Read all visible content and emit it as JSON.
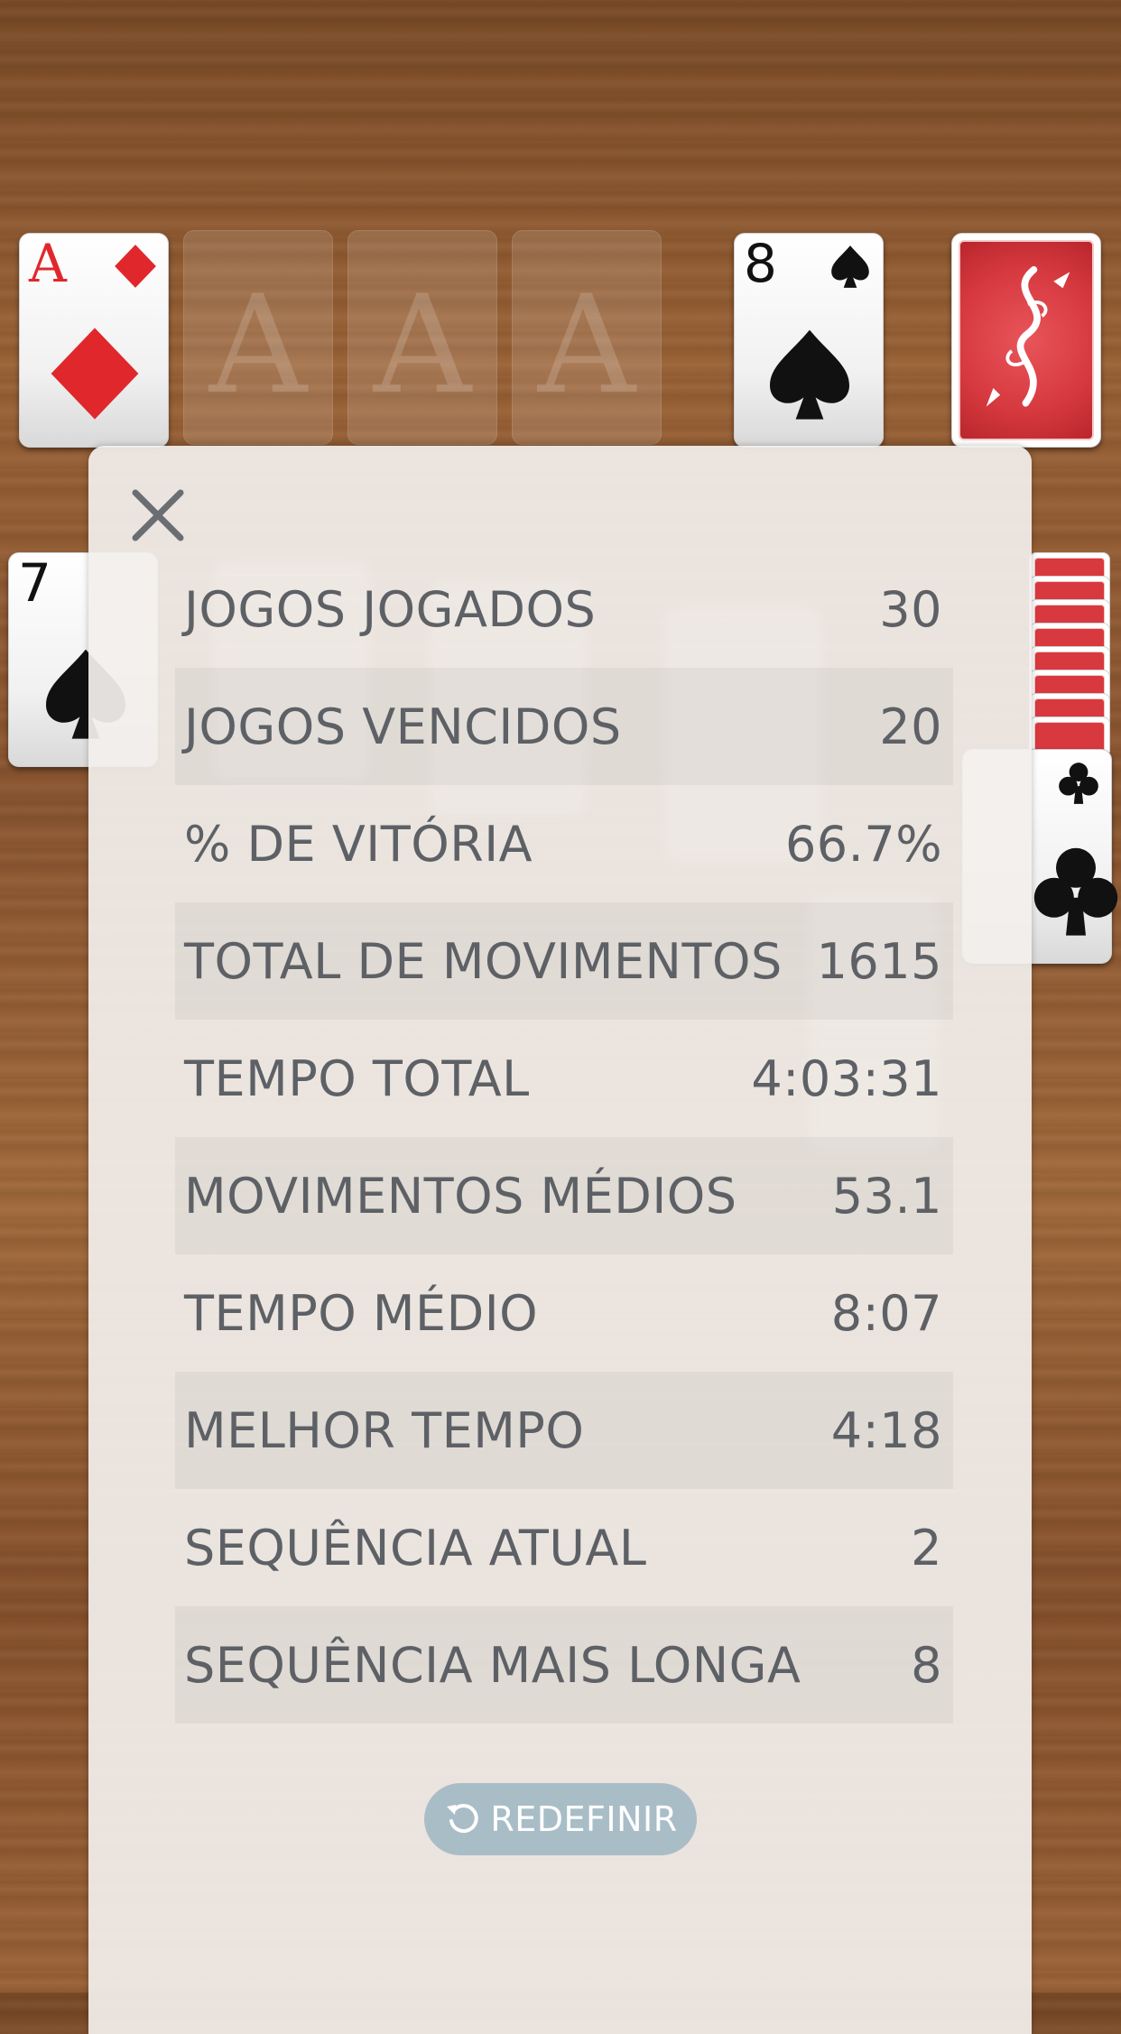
{
  "table": {
    "foundation": [
      {
        "rank": "A",
        "suit": "diamond",
        "color": "#e0282c"
      },
      {
        "placeholder": "A"
      },
      {
        "placeholder": "A"
      },
      {
        "placeholder": "A"
      }
    ],
    "waste_card": {
      "rank": "8",
      "suit": "spade"
    },
    "stock": {
      "back_color": "#d6393f"
    },
    "tableau_left_card": {
      "rank": "7",
      "suit": "spade"
    },
    "tableau_right_card": {
      "suit": "club"
    }
  },
  "stats": {
    "rows": [
      {
        "label": "JOGOS JOGADOS",
        "value": "30"
      },
      {
        "label": "JOGOS VENCIDOS",
        "value": "20"
      },
      {
        "label": "% DE VITÓRIA",
        "value": "66.7%"
      },
      {
        "label": "TOTAL DE MOVIMENTOS",
        "value": "1615"
      },
      {
        "label": "TEMPO TOTAL",
        "value": "4:03:31"
      },
      {
        "label": "MOVIMENTOS MÉDIOS",
        "value": "53.1"
      },
      {
        "label": "TEMPO MÉDIO",
        "value": "8:07"
      },
      {
        "label": "MELHOR TEMPO",
        "value": "4:18"
      },
      {
        "label": "SEQUÊNCIA ATUAL",
        "value": "2"
      },
      {
        "label": "SEQUÊNCIA MAIS LONGA",
        "value": "8"
      }
    ],
    "reset_label": "REDEFINIR",
    "close_icon": "close-icon",
    "reset_icon": "refresh-icon"
  },
  "colors": {
    "panel_text": "#5d6166",
    "reset_button": "#a9bdc7",
    "red_suit": "#e0282c"
  }
}
